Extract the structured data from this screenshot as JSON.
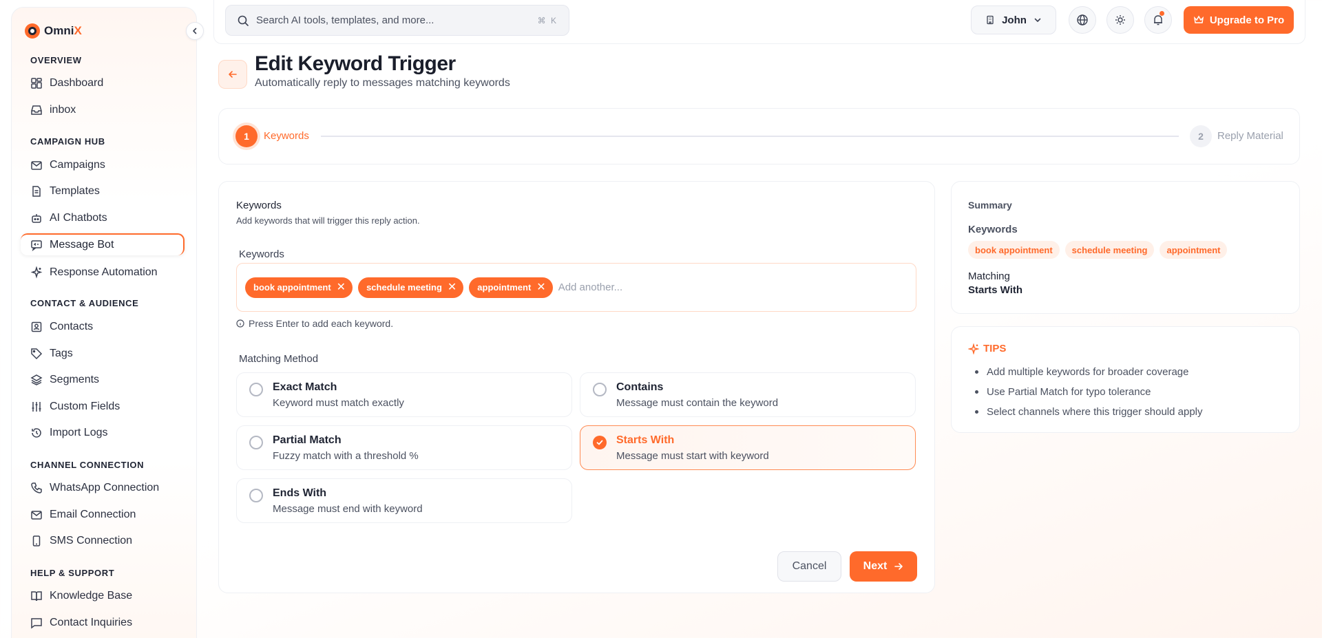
{
  "brand": {
    "name_part1": "Omni",
    "name_part2": "X"
  },
  "sidebar": {
    "sections": [
      {
        "title": "OVERVIEW"
      },
      {
        "title": "CAMPAIGN HUB"
      },
      {
        "title": "CONTACT & AUDIENCE"
      },
      {
        "title": "CHANNEL CONNECTION"
      },
      {
        "title": "HELP & SUPPORT"
      }
    ],
    "items": [
      {
        "label": "Dashboard",
        "icon": "dashboard-icon"
      },
      {
        "label": "inbox",
        "icon": "inbox-icon"
      },
      {
        "label": "Campaigns",
        "icon": "mail-icon"
      },
      {
        "label": "Templates",
        "icon": "file-icon"
      },
      {
        "label": "AI Chatbots",
        "icon": "bot-icon"
      },
      {
        "label": "Message Bot",
        "icon": "message-bot-icon",
        "active": true
      },
      {
        "label": "Response Automation",
        "icon": "sparkles-icon"
      },
      {
        "label": "Contacts",
        "icon": "contacts-icon"
      },
      {
        "label": "Tags",
        "icon": "tag-icon"
      },
      {
        "label": "Segments",
        "icon": "layers-icon"
      },
      {
        "label": "Custom Fields",
        "icon": "sliders-icon"
      },
      {
        "label": "Import Logs",
        "icon": "history-icon"
      },
      {
        "label": "WhatsApp Connection",
        "icon": "phone-icon"
      },
      {
        "label": "Email Connection",
        "icon": "mail-icon"
      },
      {
        "label": "SMS Connection",
        "icon": "mobile-icon"
      },
      {
        "label": "Knowledge Base",
        "icon": "book-icon"
      },
      {
        "label": "Contact Inquiries",
        "icon": "chat-icon"
      }
    ]
  },
  "topbar": {
    "search_placeholder": "Search AI tools, templates, and more...",
    "search_shortcut": "⌘ K",
    "user_name": "John",
    "upgrade_label": "Upgrade to Pro"
  },
  "header": {
    "title": "Edit Keyword Trigger",
    "subtitle": "Automatically reply to messages matching keywords"
  },
  "stepper": {
    "steps": [
      {
        "num": "1",
        "label": "Keywords",
        "active": true
      },
      {
        "num": "2",
        "label": "Reply Material",
        "active": false
      }
    ]
  },
  "form": {
    "section_title": "Keywords",
    "section_desc": "Add keywords that will trigger this reply action.",
    "keywords_label": "Keywords",
    "keywords": [
      "book appointment",
      "schedule meeting",
      "appointment"
    ],
    "keyword_placeholder": "Add another...",
    "hint": "Press Enter to add each keyword.",
    "matching_label": "Matching Method",
    "options": [
      {
        "title": "Exact Match",
        "desc": "Keyword must match exactly",
        "selected": false
      },
      {
        "title": "Contains",
        "desc": "Message must contain the keyword",
        "selected": false
      },
      {
        "title": "Partial Match",
        "desc": "Fuzzy match with a threshold %",
        "selected": false
      },
      {
        "title": "Starts With",
        "desc": "Message must start with keyword",
        "selected": true
      },
      {
        "title": "Ends With",
        "desc": "Message must end with keyword",
        "selected": false
      }
    ],
    "cancel_label": "Cancel",
    "next_label": "Next"
  },
  "summary": {
    "title": "Summary",
    "keywords_label": "Keywords",
    "keywords": [
      "book appointment",
      "schedule meeting",
      "appointment"
    ],
    "matching_label": "Matching",
    "matching_value": "Starts With"
  },
  "tips": {
    "title": "TIPS",
    "items": [
      "Add multiple keywords for broader coverage",
      "Use Partial Match for typo tolerance",
      "Select channels where this trigger should apply"
    ]
  },
  "colors": {
    "accent": "#ff6a2b",
    "accent_soft": "#fff0e8",
    "text": "#1f2433",
    "muted": "#4b5160"
  }
}
